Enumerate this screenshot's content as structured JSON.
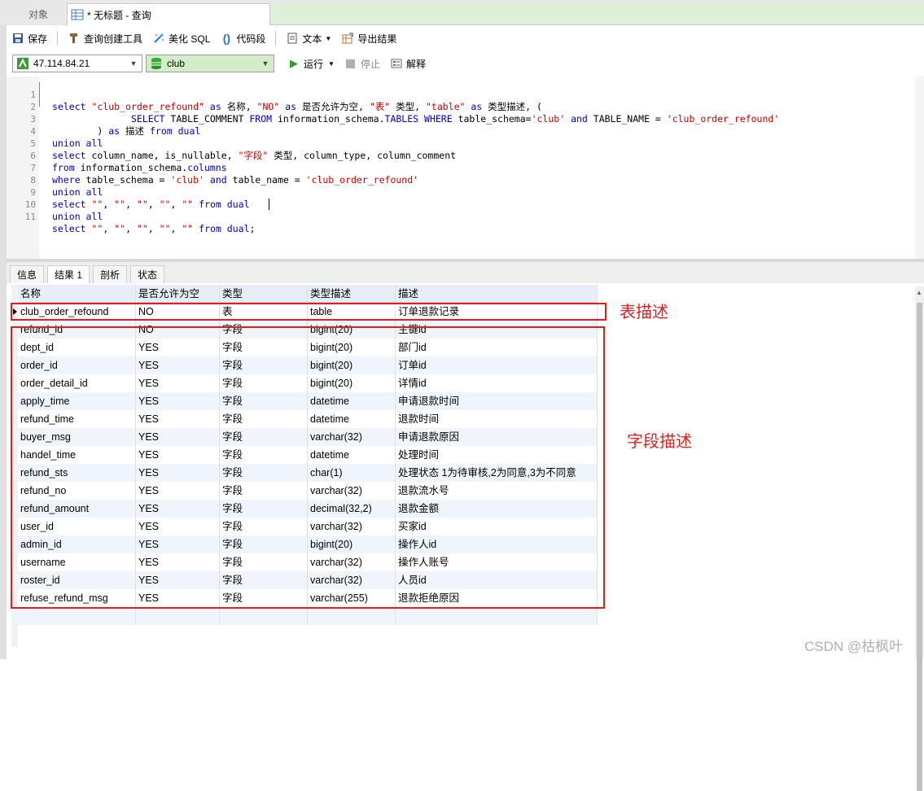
{
  "tabs": {
    "objects_label": "对象",
    "query_label": "* 无标题 - 查询"
  },
  "toolbar1": {
    "save": "保存",
    "query_builder": "查询创建工具",
    "beautify": "美化 SQL",
    "snippet": "代码段",
    "text": "文本",
    "export": "导出结果"
  },
  "toolbar2": {
    "connection": "47.114.84.21",
    "database": "club",
    "run": "运行",
    "stop": "停止",
    "explain": "解释"
  },
  "editor": {
    "line_numbers": [
      "1",
      "2",
      "3",
      "4",
      "5",
      "6",
      "7",
      "8",
      "9",
      "10",
      "11"
    ]
  },
  "result_tabs": {
    "info": "信息",
    "result1": "结果 1",
    "profile": "剖析",
    "status": "状态"
  },
  "grid": {
    "headers": [
      "名称",
      "是否允许为空",
      "类型",
      "类型描述",
      "描述"
    ],
    "rows": [
      [
        "club_order_refound",
        "NO",
        "表",
        "table",
        "订单退款记录"
      ],
      [
        "refund_id",
        "NO",
        "字段",
        "bigint(20)",
        "主键id"
      ],
      [
        "dept_id",
        "YES",
        "字段",
        "bigint(20)",
        "部门id"
      ],
      [
        "order_id",
        "YES",
        "字段",
        "bigint(20)",
        "订单id"
      ],
      [
        "order_detail_id",
        "YES",
        "字段",
        "bigint(20)",
        "详情id"
      ],
      [
        "apply_time",
        "YES",
        "字段",
        "datetime",
        "申请退款时间"
      ],
      [
        "refund_time",
        "YES",
        "字段",
        "datetime",
        "退款时间"
      ],
      [
        "buyer_msg",
        "YES",
        "字段",
        "varchar(32)",
        "申请退款原因"
      ],
      [
        "handel_time",
        "YES",
        "字段",
        "datetime",
        "处理时间"
      ],
      [
        "refund_sts",
        "YES",
        "字段",
        "char(1)",
        "处理状态 1为待审核,2为同意,3为不同意"
      ],
      [
        "refund_no",
        "YES",
        "字段",
        "varchar(32)",
        "退款流水号"
      ],
      [
        "refund_amount",
        "YES",
        "字段",
        "decimal(32,2)",
        "退款金额"
      ],
      [
        "user_id",
        "YES",
        "字段",
        "varchar(32)",
        "买家id"
      ],
      [
        "admin_id",
        "YES",
        "字段",
        "bigint(20)",
        "操作人id"
      ],
      [
        "username",
        "YES",
        "字段",
        "varchar(32)",
        "操作人账号"
      ],
      [
        "roster_id",
        "YES",
        "字段",
        "varchar(32)",
        "人员id"
      ],
      [
        "refuse_refund_msg",
        "YES",
        "字段",
        "varchar(255)",
        "退款拒绝原因"
      ],
      [
        "",
        "",
        "",
        "",
        ""
      ]
    ]
  },
  "annotations": {
    "table_desc": "表描述",
    "field_desc": "字段描述"
  },
  "watermark": "CSDN @枯枫叶",
  "colors": {
    "keyword": "#0000c8",
    "string": "#c80000",
    "annotation": "#e02020"
  }
}
